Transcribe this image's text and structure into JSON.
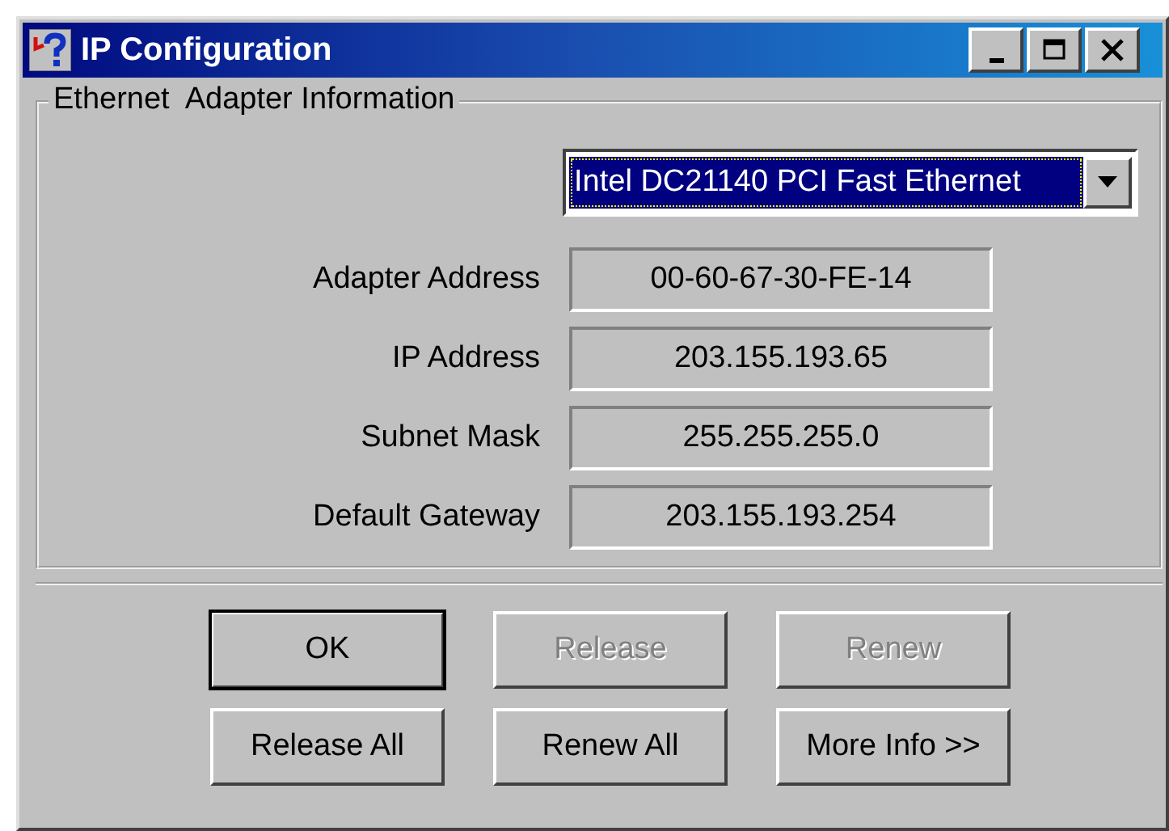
{
  "window": {
    "title": "IP Configuration"
  },
  "group": {
    "title": "Ethernet  Adapter Information"
  },
  "adapter_dropdown": {
    "value": "Intel DC21140 PCI Fast Ethernet"
  },
  "fields": [
    {
      "label": "Adapter Address",
      "value": "00-60-67-30-FE-14"
    },
    {
      "label": "IP Address",
      "value": "203.155.193.65"
    },
    {
      "label": "Subnet Mask",
      "value": "255.255.255.0"
    },
    {
      "label": "Default Gateway",
      "value": "203.155.193.254"
    }
  ],
  "buttons": [
    {
      "label": "OK",
      "default": true,
      "disabled": false
    },
    {
      "label": "Release",
      "default": false,
      "disabled": true
    },
    {
      "label": "Renew",
      "default": false,
      "disabled": true
    },
    {
      "label": "Release All",
      "default": false,
      "disabled": false
    },
    {
      "label": "Renew All",
      "default": false,
      "disabled": false
    },
    {
      "label": "More Info >>",
      "default": false,
      "disabled": false
    }
  ]
}
